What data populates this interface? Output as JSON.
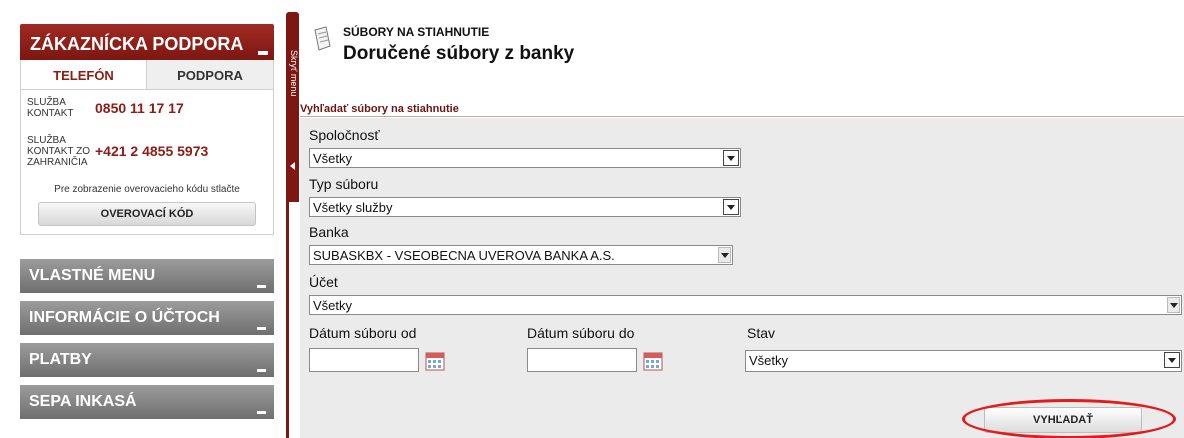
{
  "sidebar": {
    "support_title": "ZÁKAZNÍCKA PODPORA",
    "tabs": [
      "TELEFÓN",
      "PODPORA"
    ],
    "contacts": [
      {
        "label": "SLUŽBA KONTAKT",
        "number": "0850 11 17 17"
      },
      {
        "label": "SLUŽBA KONTAKT ZO ZAHRANIČIA",
        "number": "+421 2 4855 5973"
      }
    ],
    "verify_text": "Pre zobrazenie overovacieho kódu stlačte",
    "verify_button": "OVEROVACÍ KÓD",
    "menu": [
      "VLASTNÉ MENU",
      "INFORMÁCIE O ÚČTOCH",
      "PLATBY",
      "SEPA INKASÁ"
    ]
  },
  "collapse": {
    "label": "Skryť menu"
  },
  "page": {
    "supertitle": "SÚBORY NA STIAHNUTIE",
    "title": "Doručené súbory z banky",
    "section_title": "Vyhľadať súbory na stiahnutie"
  },
  "form": {
    "company_label": "Spoločnosť",
    "company_value": "Všetky",
    "filetype_label": "Typ súboru",
    "filetype_value": "Všetky služby",
    "bank_label": "Banka",
    "bank_value": "SUBASKBX - VSEOBECNA UVEROVA BANKA A.S.",
    "account_label": "Účet",
    "account_value": "Všetky",
    "date_from_label": "Dátum súboru od",
    "date_to_label": "Dátum súboru do",
    "status_label": "Stav",
    "status_value": "Všetky",
    "search_button": "VYHĽADAŤ"
  },
  "colors": {
    "brand": "#8c1c15",
    "highlight": "#e31b1b",
    "menu": "#8a8a8a"
  }
}
